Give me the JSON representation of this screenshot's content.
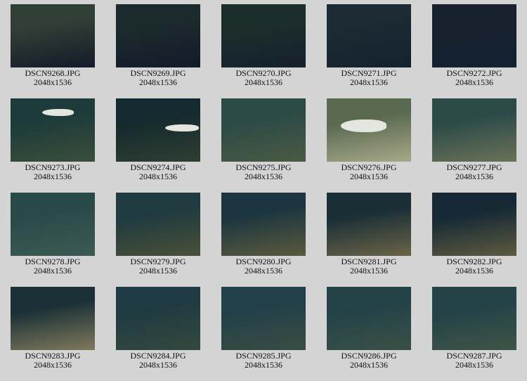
{
  "images": [
    {
      "filename": "DSCN9268.JPG",
      "dimensions": "2048x1536",
      "colors": [
        "#2f3f35",
        "#141a2a"
      ]
    },
    {
      "filename": "DSCN9269.JPG",
      "dimensions": "2048x1536",
      "colors": [
        "#1b2a2c",
        "#131a2b"
      ]
    },
    {
      "filename": "DSCN9270.JPG",
      "dimensions": "2048x1536",
      "colors": [
        "#1c2e2c",
        "#14202c"
      ]
    },
    {
      "filename": "DSCN9271.JPG",
      "dimensions": "2048x1536",
      "colors": [
        "#1b2a33",
        "#15222e"
      ]
    },
    {
      "filename": "DSCN9272.JPG",
      "dimensions": "2048x1536",
      "colors": [
        "#17222e",
        "#132131"
      ]
    },
    {
      "filename": "DSCN9273.JPG",
      "dimensions": "2048x1536",
      "colors": [
        "#1d3b3a",
        "#3a4e3a"
      ],
      "fish": true
    },
    {
      "filename": "DSCN9274.JPG",
      "dimensions": "2048x1536",
      "colors": [
        "#152a2e",
        "#2e3e32"
      ],
      "fish": true
    },
    {
      "filename": "DSCN9275.JPG",
      "dimensions": "2048x1536",
      "colors": [
        "#2c4a46",
        "#4a5a44"
      ]
    },
    {
      "filename": "DSCN9276.JPG",
      "dimensions": "2048x1536",
      "colors": [
        "#5a6a50",
        "#a8a88a"
      ],
      "fish": true
    },
    {
      "filename": "DSCN9277.JPG",
      "dimensions": "2048x1536",
      "colors": [
        "#2c4a48",
        "#6a7258"
      ]
    },
    {
      "filename": "DSCN9278.JPG",
      "dimensions": "2048x1536",
      "colors": [
        "#2a4a4a",
        "#3c5a52"
      ]
    },
    {
      "filename": "DSCN9279.JPG",
      "dimensions": "2048x1536",
      "colors": [
        "#1f3a40",
        "#4a5038"
      ]
    },
    {
      "filename": "DSCN9280.JPG",
      "dimensions": "2048x1536",
      "colors": [
        "#1d3540",
        "#5a5a3c"
      ]
    },
    {
      "filename": "DSCN9281.JPG",
      "dimensions": "2048x1536",
      "colors": [
        "#1a2e36",
        "#6a6446"
      ]
    },
    {
      "filename": "DSCN9282.JPG",
      "dimensions": "2048x1536",
      "colors": [
        "#152834",
        "#5e5a40"
      ]
    },
    {
      "filename": "DSCN9283.JPG",
      "dimensions": "2048x1536",
      "colors": [
        "#1b3036",
        "#807a5c"
      ]
    },
    {
      "filename": "DSCN9284.JPG",
      "dimensions": "2048x1536",
      "colors": [
        "#1f3a42",
        "#34483e"
      ]
    },
    {
      "filename": "DSCN9285.JPG",
      "dimensions": "2048x1536",
      "colors": [
        "#22404a",
        "#3a4c42"
      ]
    },
    {
      "filename": "DSCN9286.JPG",
      "dimensions": "2048x1536",
      "colors": [
        "#234248",
        "#3a5046"
      ]
    },
    {
      "filename": "DSCN9287.JPG",
      "dimensions": "2048x1536",
      "colors": [
        "#234248",
        "#3e5446"
      ]
    }
  ]
}
